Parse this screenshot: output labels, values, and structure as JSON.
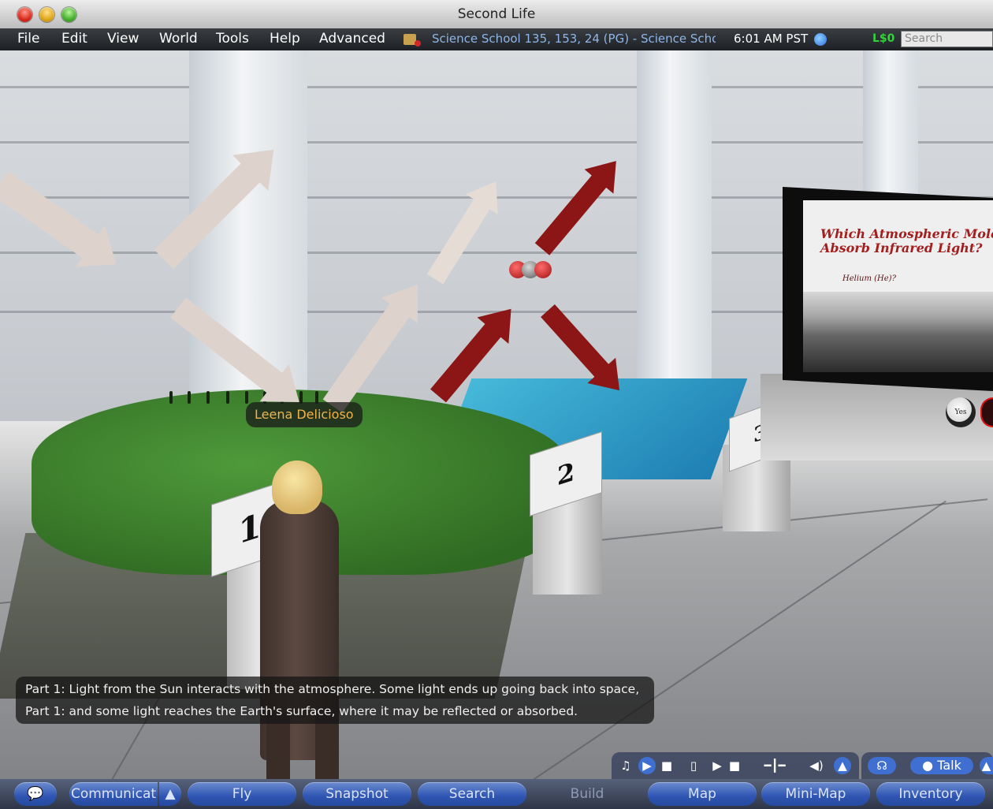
{
  "window": {
    "title": "Second Life"
  },
  "menu": {
    "items": [
      "File",
      "Edit",
      "View",
      "World",
      "Tools",
      "Help",
      "Advanced"
    ]
  },
  "status": {
    "location": "Science School 135, 153, 24 (PG) - Science Scho",
    "time": "6:01 AM PST",
    "balance": "L$0",
    "search_placeholder": "Search"
  },
  "scene": {
    "avatar_name": "Leena Delicioso",
    "pedestals": [
      "1",
      "2",
      "3"
    ],
    "board": {
      "title_line1": "Which Atmospheric Molecule",
      "title_line2": "Absorb Infrared Light?",
      "option": "Helium (He)?",
      "yes_label": "Yes"
    },
    "colors": {
      "light_arrow": "#ddd3cc",
      "ir_arrow": "#8c1515",
      "grass": "#3c7f2c",
      "water": "#2f9fcf"
    }
  },
  "chat": {
    "lines": [
      "Part 1: Light from the Sun interacts with the atmosphere.  Some light ends up going back into space,",
      "Part 1: and some light reaches the Earth's surface, where it may be reflected or absorbed."
    ]
  },
  "media": {
    "talk_label": "Talk"
  },
  "toolbar": {
    "communicate": "Communicat",
    "fly": "Fly",
    "snapshot": "Snapshot",
    "search": "Search",
    "build": "Build",
    "map": "Map",
    "minimap": "Mini-Map",
    "inventory": "Inventory"
  }
}
